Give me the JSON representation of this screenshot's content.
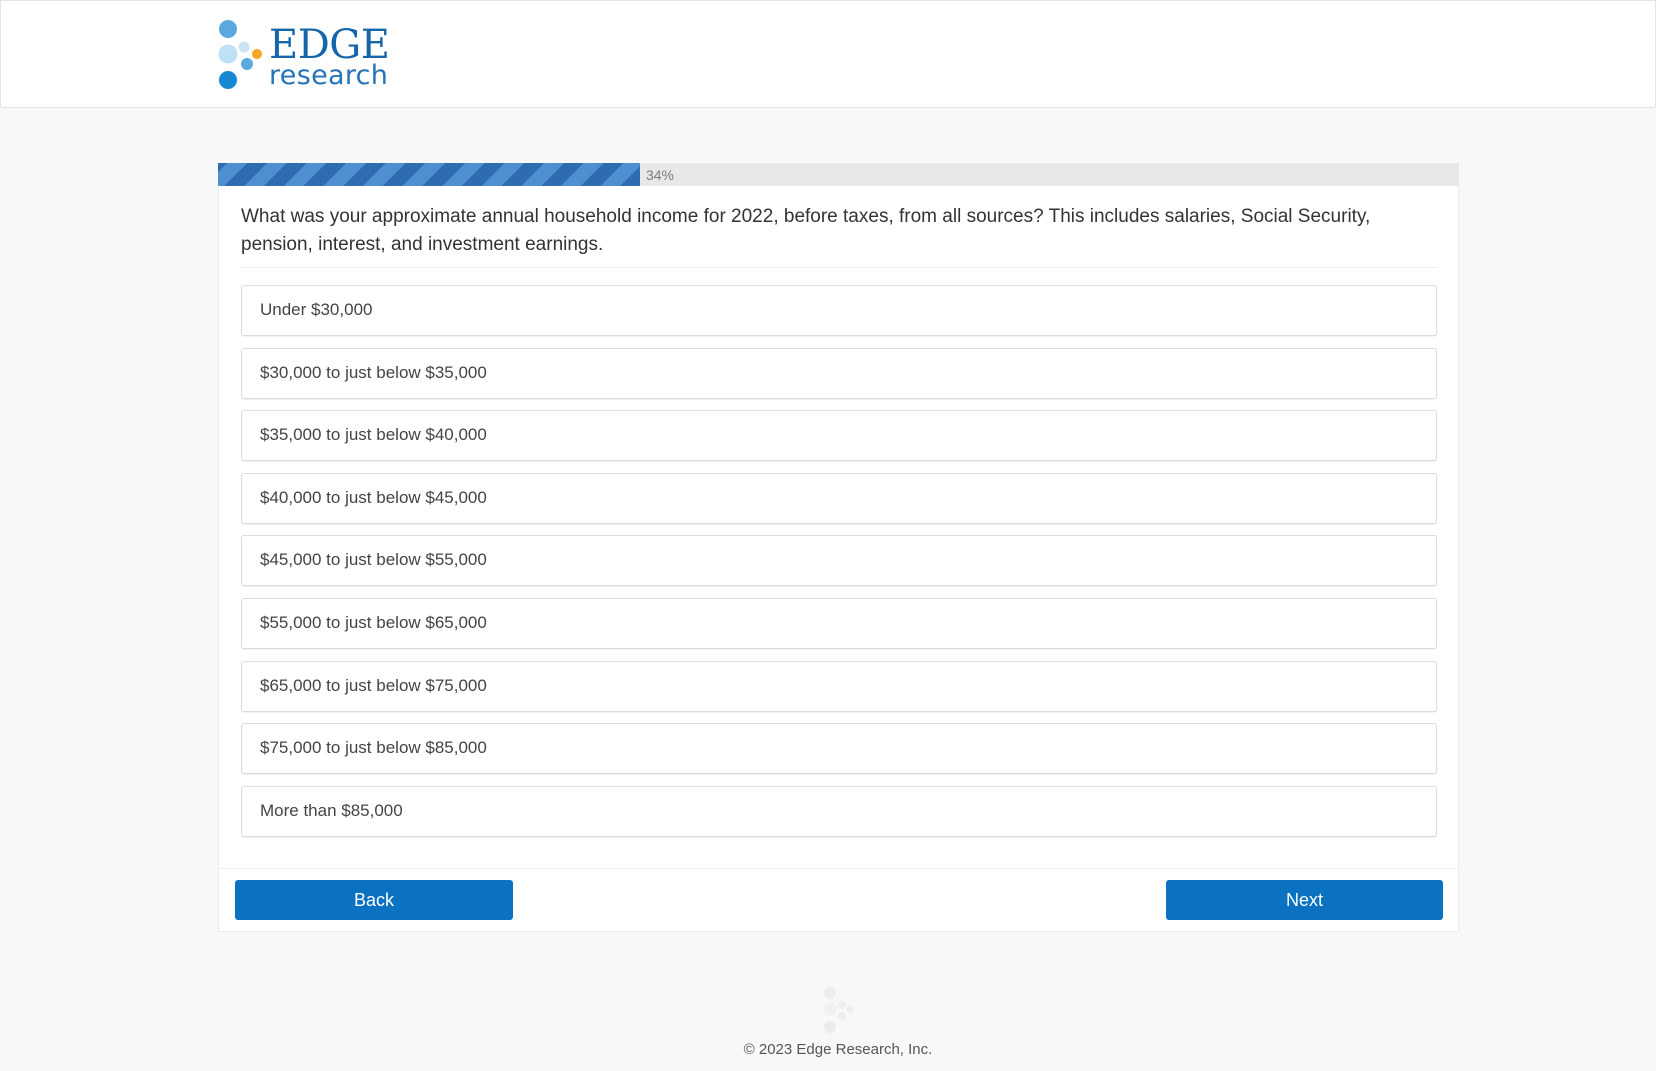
{
  "brand": {
    "name": "EDGE",
    "tagline": "research",
    "colors": {
      "primary": "#1565a8",
      "dot_blue": "#3d9ad8",
      "dot_light": "#bfe1f5",
      "dot_orange": "#f5a623"
    }
  },
  "progress": {
    "percent": 34,
    "label": "34%"
  },
  "question": {
    "text": "What was your approximate annual household income for 2022, before taxes, from all sources? This includes salaries, Social Security, pension, interest, and investment earnings."
  },
  "options": [
    {
      "label": "Under $30,000"
    },
    {
      "label": "$30,000 to just below $35,000"
    },
    {
      "label": "$35,000 to just below $40,000"
    },
    {
      "label": "$40,000 to just below $45,000"
    },
    {
      "label": "$45,000 to just below $55,000"
    },
    {
      "label": "$55,000 to just below $65,000"
    },
    {
      "label": "$65,000 to just below $75,000"
    },
    {
      "label": "$75,000 to just below $85,000"
    },
    {
      "label": "More than $85,000"
    }
  ],
  "nav": {
    "back_label": "Back",
    "next_label": "Next",
    "button_color": "#0b72c2"
  },
  "footer": {
    "copyright": "© 2023 Edge Research, Inc."
  }
}
